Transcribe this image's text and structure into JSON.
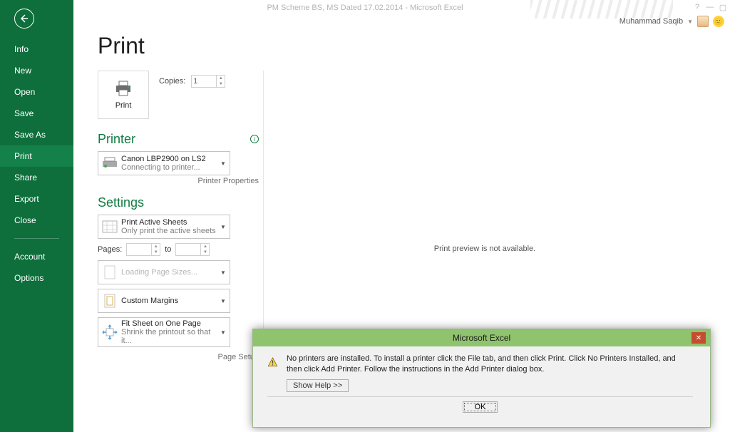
{
  "titlebar": {
    "title": "PM Scheme BS, MS Dated 17.02.2014 - Microsoft Excel"
  },
  "account": {
    "name": "Muhammad Saqib"
  },
  "sidebar": {
    "items": [
      "Info",
      "New",
      "Open",
      "Save",
      "Save As",
      "Print",
      "Share",
      "Export",
      "Close"
    ],
    "bottom": [
      "Account",
      "Options"
    ],
    "active_index": 5
  },
  "page": {
    "title": "Print"
  },
  "print_button": {
    "label": "Print"
  },
  "copies": {
    "label": "Copies:",
    "value": "1"
  },
  "printer_section": {
    "heading": "Printer",
    "device": "Canon LBP2900 on LS2",
    "status": "Connecting to printer...",
    "properties_link": "Printer Properties"
  },
  "settings_section": {
    "heading": "Settings",
    "what_to_print": {
      "title": "Print Active Sheets",
      "sub": "Only print the active sheets"
    },
    "pages": {
      "label": "Pages:",
      "to": "to"
    },
    "page_size": {
      "title": "Loading Page Sizes..."
    },
    "margins": {
      "title": "Custom Margins"
    },
    "scaling": {
      "title": "Fit Sheet on One Page",
      "sub": "Shrink the printout so that it..."
    },
    "page_setup_link": "Page Setup"
  },
  "preview": {
    "not_available": "Print preview is not available."
  },
  "dialog": {
    "title": "Microsoft Excel",
    "body": "No printers are installed. To install a printer click the File tab, and then click Print. Click No Printers Installed, and then click Add Printer. Follow the instructions in the Add Printer dialog box.",
    "show_help": "Show Help >>",
    "ok": "OK"
  }
}
